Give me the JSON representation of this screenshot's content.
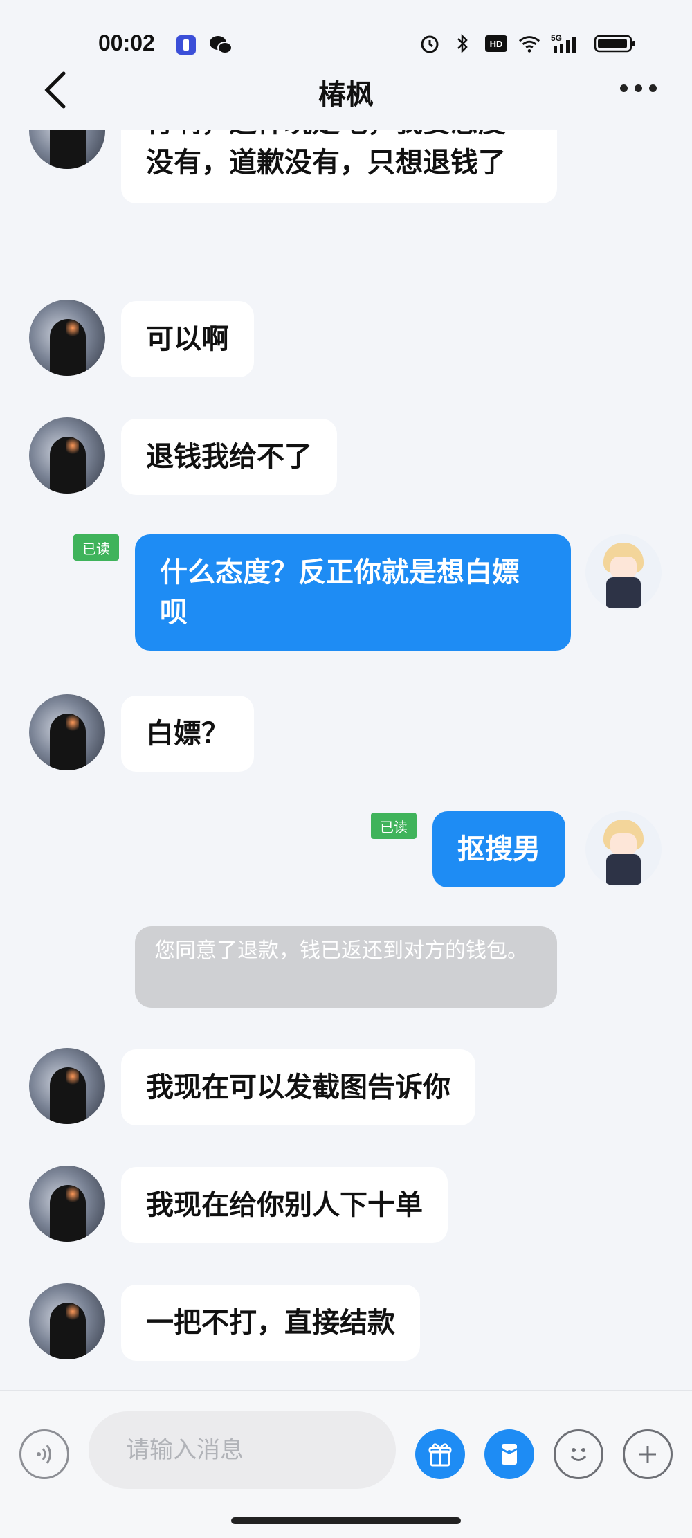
{
  "status_bar": {
    "time": "00:02",
    "left_icons": [
      "flashlight-icon",
      "wechat-icon"
    ],
    "right_icons": [
      "alarm-icon",
      "bluetooth-icon",
      "hd-icon",
      "wifi-icon",
      "signal-5g-icon",
      "battery-icon"
    ],
    "hd_label": "HD",
    "network_label": "5G"
  },
  "header": {
    "title": "椿枫"
  },
  "messages": [
    {
      "side": "left",
      "text": "行啊，这样玩是吧，我要态度没有，道歉没有，只想退钱了"
    },
    {
      "side": "left",
      "text": "可以啊"
    },
    {
      "side": "left",
      "text": "退钱我给不了"
    },
    {
      "side": "right",
      "text": "什么态度？反正你就是想白嫖呗",
      "read_label": "已读"
    },
    {
      "side": "left",
      "text": "白嫖？"
    },
    {
      "side": "right",
      "text": "抠搜男",
      "read_label": "已读"
    },
    {
      "side": "system",
      "text": "您同意了退款，钱已返还到对方的钱包。"
    },
    {
      "side": "left",
      "text": "我现在可以发截图告诉你"
    },
    {
      "side": "left",
      "text": "我现在给你别人下十单"
    },
    {
      "side": "left",
      "text": "一把不打，直接结款"
    }
  ],
  "input": {
    "placeholder": "请输入消息",
    "value": ""
  },
  "colors": {
    "accent": "#1e8cf4",
    "read_badge": "#3fb35b",
    "background": "#f3f5f9"
  }
}
